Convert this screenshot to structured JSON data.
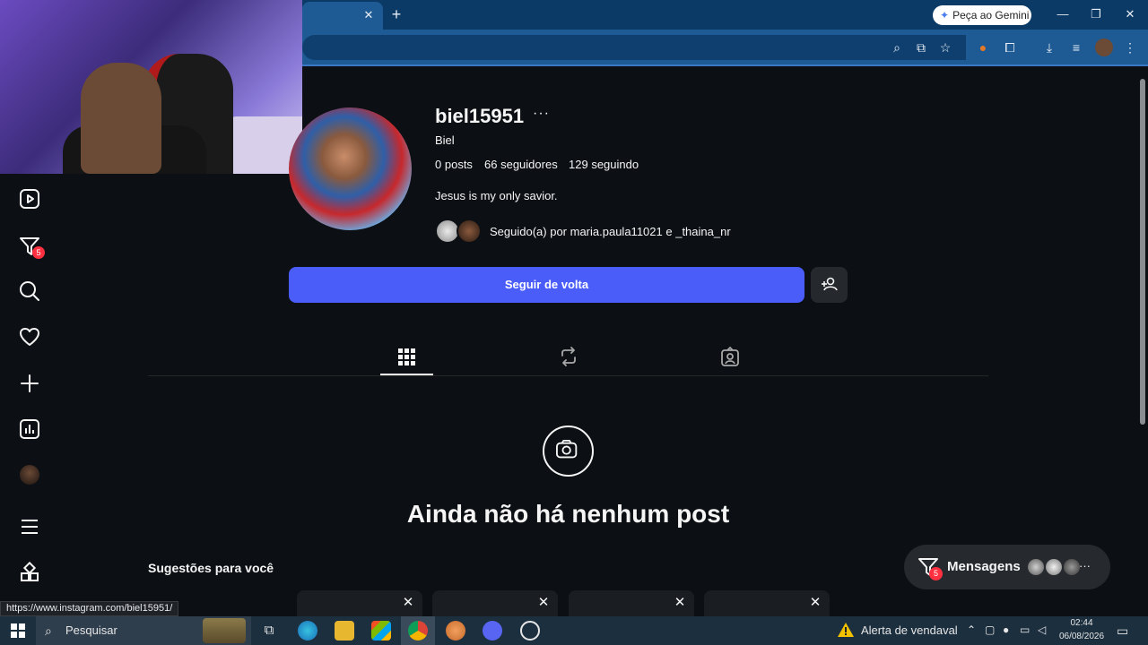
{
  "browser": {
    "gemini_label": "Peça ao Gemini",
    "tab_close": "✕",
    "new_tab": "+",
    "window_controls": {
      "minimize": "—",
      "restore": "❐",
      "close": "✕"
    },
    "toolbar_icons": [
      "zoom-icon",
      "install-icon",
      "bookmark-star-icon",
      "extension-puzzle-icon",
      "download-icon",
      "media-icon",
      "profile-icon",
      "menu-icon"
    ]
  },
  "status_url": "https://www.instagram.com/biel15951/",
  "profile": {
    "username": "biel15951",
    "more": "···",
    "full_name": "Biel",
    "posts_count": "0",
    "posts_label": "posts",
    "followers_count": "66",
    "followers_label": "seguidores",
    "following_count": "129",
    "following_label": "seguindo",
    "bio": "Jesus is my only savior.",
    "followed_by_prefix": "Seguido(a) por ",
    "followed_by_user1": "maria.paula11021",
    "followed_by_joiner": " e ",
    "followed_by_user2": "_thaina_nr",
    "follow_button": "Seguir de volta"
  },
  "nav": {
    "notification_count": "5",
    "items": [
      "reels-icon",
      "messages-icon",
      "search-icon",
      "heart-icon",
      "create-icon",
      "dashboard-icon",
      "profile-avatar",
      "menu-icon",
      "more-apps-icon"
    ]
  },
  "tabs": [
    "posts-grid-icon",
    "reposts-icon",
    "tagged-icon"
  ],
  "empty_state": {
    "title": "Ainda não há nenhum post"
  },
  "suggestions": {
    "title": "Sugestões para você",
    "close": "✕"
  },
  "messages": {
    "label": "Mensagens",
    "badge": "5",
    "more": "···"
  },
  "taskbar": {
    "search_placeholder": "Pesquisar",
    "weather_label": "Alerta de vendaval",
    "time": "02:44",
    "date": "06/08/2026"
  },
  "colors": {
    "accent_button": "#4a5df9",
    "background": "#0c1014",
    "badge": "#ff3040",
    "browser_frame": "#1e5a93"
  }
}
